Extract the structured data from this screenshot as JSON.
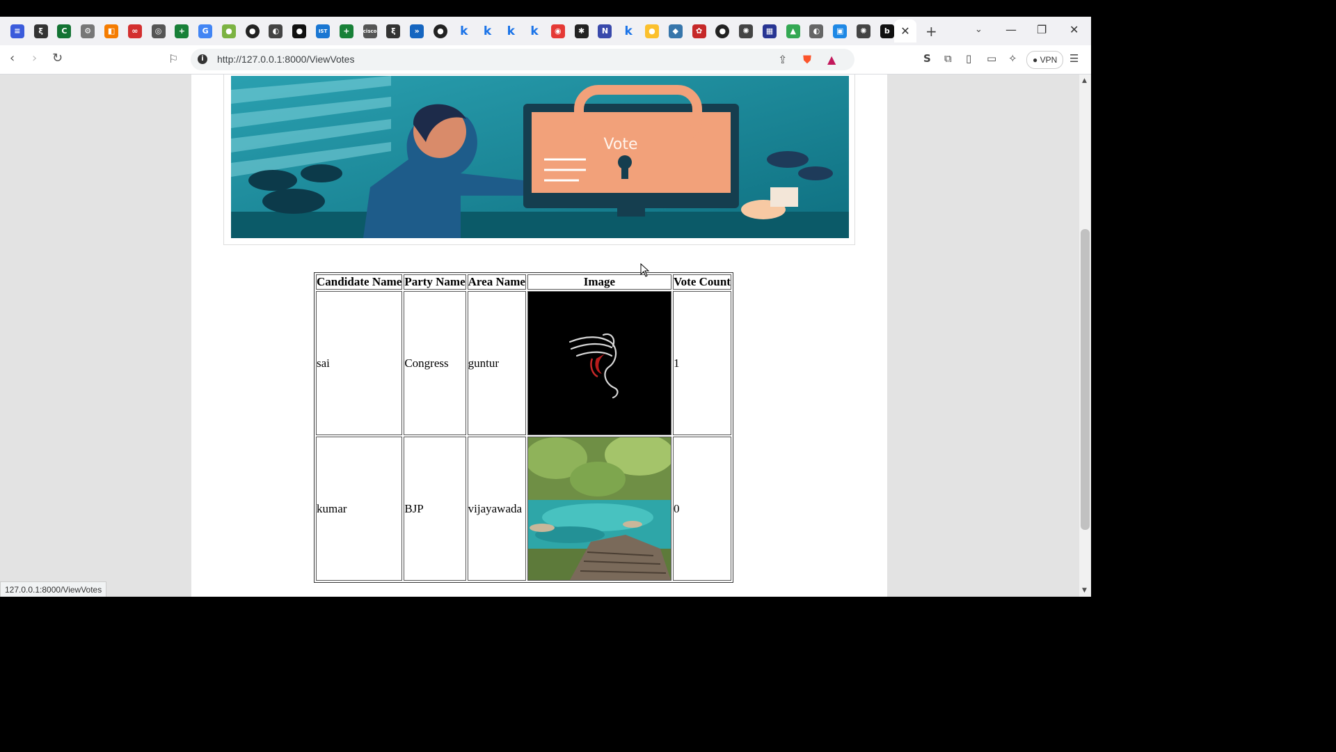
{
  "browser": {
    "address_url": "http://127.0.0.1:8000/ViewVotes",
    "status_url": "127.0.0.1:8000/ViewVotes",
    "vpn_label": "VPN",
    "active_tab_close": "✕",
    "tab_icons": [
      {
        "name": "tab-icon-1",
        "glyph": "≡",
        "bg": "#3b5bdb"
      },
      {
        "name": "tab-icon-2",
        "glyph": "ξ",
        "bg": "#333"
      },
      {
        "name": "tab-icon-3",
        "glyph": "C",
        "bg": "#137333"
      },
      {
        "name": "tab-icon-4",
        "glyph": "⚙",
        "bg": "#777"
      },
      {
        "name": "tab-icon-5",
        "glyph": "◧",
        "bg": "#f57c00"
      },
      {
        "name": "tab-icon-6",
        "glyph": "∞",
        "bg": "#d32f2f"
      },
      {
        "name": "tab-icon-7",
        "glyph": "◎",
        "bg": "#555"
      },
      {
        "name": "tab-icon-8",
        "glyph": "+",
        "bg": "#188038"
      },
      {
        "name": "tab-icon-9",
        "glyph": "G",
        "bg": "#4285f4"
      },
      {
        "name": "tab-icon-10",
        "glyph": "●",
        "bg": "#7cb342"
      },
      {
        "name": "github-icon",
        "glyph": "●",
        "bg": "gh"
      },
      {
        "name": "tab-icon-12",
        "glyph": "◐",
        "bg": "#444"
      },
      {
        "name": "tab-icon-13",
        "glyph": "●",
        "bg": "#111"
      },
      {
        "name": "tab-icon-14",
        "glyph": "IST",
        "bg": "#1976d2"
      },
      {
        "name": "tab-icon-15",
        "glyph": "+",
        "bg": "#188038"
      },
      {
        "name": "tab-icon-16",
        "glyph": "cisco",
        "bg": "#555"
      },
      {
        "name": "tab-icon-17",
        "glyph": "ξ",
        "bg": "#333"
      },
      {
        "name": "tab-icon-18",
        "glyph": "»",
        "bg": "#1565c0"
      },
      {
        "name": "github-icon",
        "glyph": "●",
        "bg": "gh"
      },
      {
        "name": "kaggle-icon",
        "glyph": "k",
        "bg": "k"
      },
      {
        "name": "kaggle-icon",
        "glyph": "k",
        "bg": "k"
      },
      {
        "name": "kaggle-icon",
        "glyph": "k",
        "bg": "k"
      },
      {
        "name": "kaggle-icon",
        "glyph": "k",
        "bg": "k"
      },
      {
        "name": "tab-icon-24",
        "glyph": "◉",
        "bg": "#e53935"
      },
      {
        "name": "tab-icon-25",
        "glyph": "✱",
        "bg": "#222"
      },
      {
        "name": "tab-icon-26",
        "glyph": "N",
        "bg": "#3949ab"
      },
      {
        "name": "kaggle-icon",
        "glyph": "k",
        "bg": "k"
      },
      {
        "name": "tab-icon-28",
        "glyph": "●",
        "bg": "#fbc02d"
      },
      {
        "name": "python-icon",
        "glyph": "◆",
        "bg": "#3776ab"
      },
      {
        "name": "tab-icon-30",
        "glyph": "✿",
        "bg": "#c62828"
      },
      {
        "name": "github-icon",
        "glyph": "●",
        "bg": "gh"
      },
      {
        "name": "openai-icon",
        "glyph": "✺",
        "bg": "#444"
      },
      {
        "name": "tab-icon-33",
        "glyph": "▦",
        "bg": "#283593"
      },
      {
        "name": "drive-icon",
        "glyph": "▲",
        "bg": "#34a853"
      },
      {
        "name": "globe-icon",
        "glyph": "◐",
        "bg": "#666"
      },
      {
        "name": "tab-icon-36",
        "glyph": "▣",
        "bg": "#1e88e5"
      },
      {
        "name": "openai-icon",
        "glyph": "✺",
        "bg": "#444"
      },
      {
        "name": "tab-icon-38",
        "glyph": "b",
        "bg": "#111"
      }
    ]
  },
  "table": {
    "headers": [
      "Candidate Name",
      "Party Name",
      "Area Name",
      "Image",
      "Vote Count"
    ],
    "rows": [
      {
        "candidate": "sai",
        "party": "Congress",
        "area": "guntur",
        "vote_count": "1",
        "image": "dragon-logo"
      },
      {
        "candidate": "kumar",
        "party": "BJP",
        "area": "vijayawada",
        "vote_count": "0",
        "image": "lake-landscape"
      }
    ]
  },
  "banner": {
    "screen_text": "Vote"
  }
}
